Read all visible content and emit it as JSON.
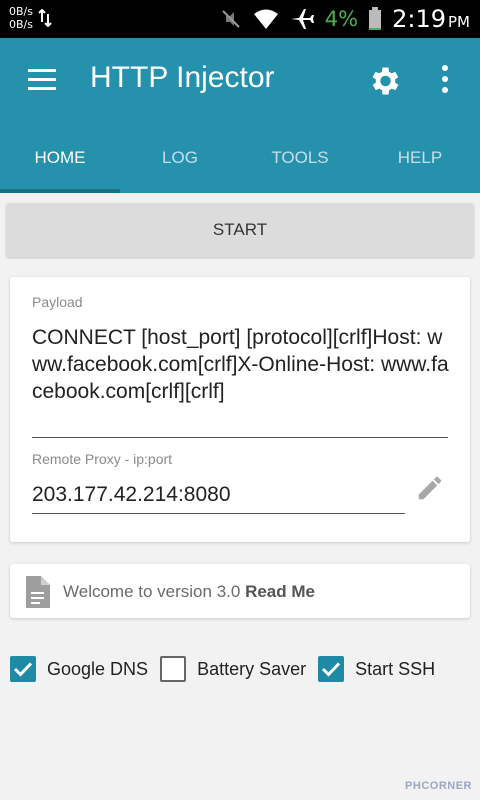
{
  "status_bar": {
    "net_up": "0B/s",
    "net_down": "0B/s",
    "battery_percent": "4%",
    "time": "2:19",
    "ampm": "PM"
  },
  "app_bar": {
    "title": "HTTP Injector",
    "tabs": [
      {
        "label": "HOME",
        "active": true
      },
      {
        "label": "LOG",
        "active": false
      },
      {
        "label": "TOOLS",
        "active": false
      },
      {
        "label": "HELP",
        "active": false
      }
    ]
  },
  "start_button": {
    "label": "START"
  },
  "payload": {
    "label": "Payload",
    "value": "CONNECT [host_port] [protocol][crlf]Host: www.facebook.com[crlf]X-Online-Host: www.facebook.com[crlf][crlf]"
  },
  "remote_proxy": {
    "label": "Remote Proxy - ip:port",
    "value": "203.177.42.214:8080"
  },
  "welcome": {
    "text": "Welcome to version 3.0",
    "link": "Read Me"
  },
  "options": [
    {
      "label": "Google DNS",
      "checked": true
    },
    {
      "label": "Battery Saver",
      "checked": false
    },
    {
      "label": "Start SSH",
      "checked": true
    }
  ],
  "watermark": "PHCORNER",
  "colors": {
    "primary": "#2591ad",
    "accent": "#1f8aa5",
    "battery_low": "#4caf50"
  },
  "icons": [
    "menu-icon",
    "gear-icon",
    "more-vert-icon",
    "edit-icon",
    "document-icon",
    "mute-icon",
    "wifi-icon",
    "airplane-icon",
    "battery-icon"
  ]
}
